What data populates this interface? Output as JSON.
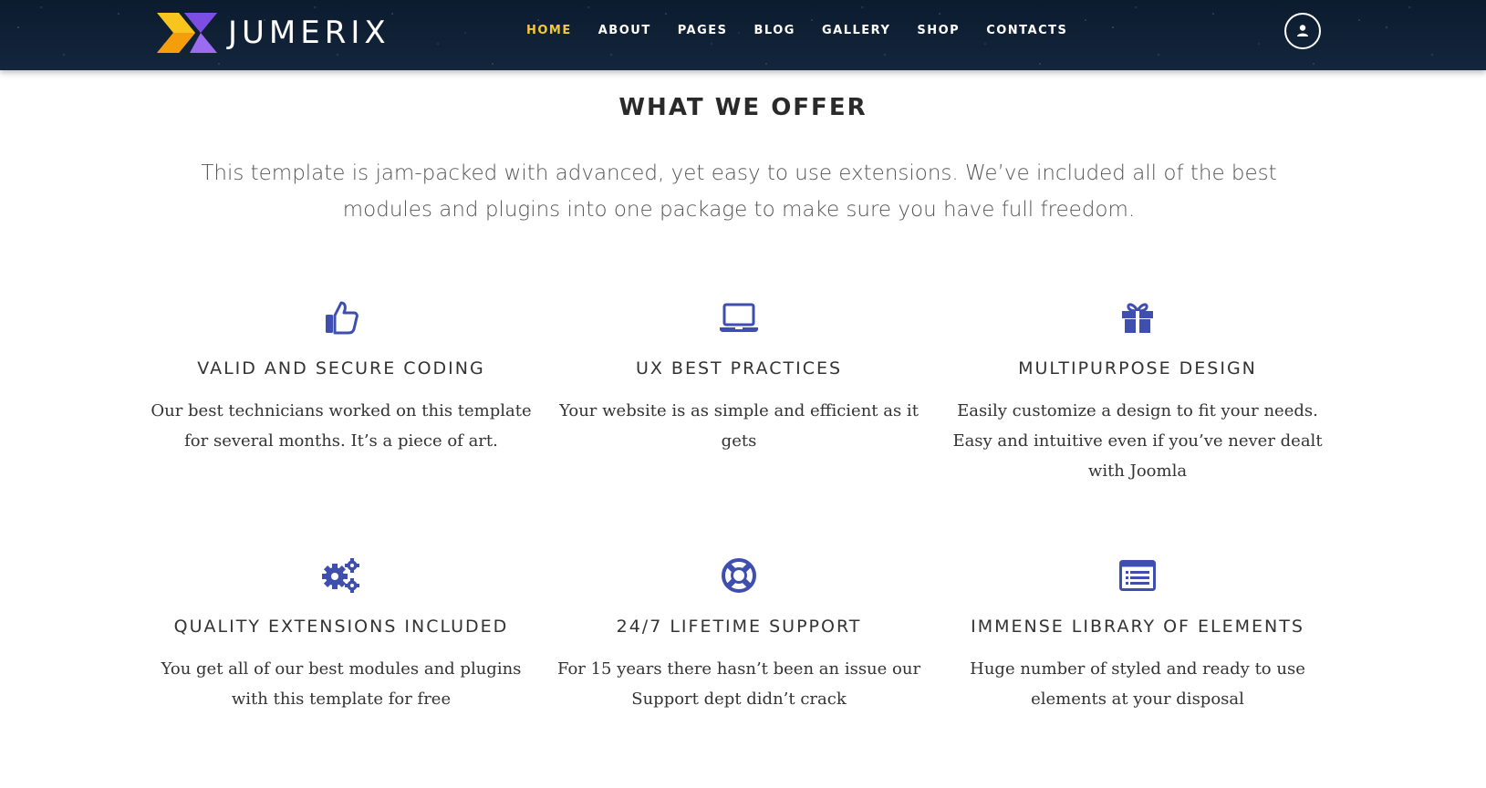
{
  "header": {
    "logo_text": "JUMERIX",
    "nav": [
      {
        "label": "HOME",
        "active": true
      },
      {
        "label": "ABOUT",
        "active": false
      },
      {
        "label": "PAGES",
        "active": false
      },
      {
        "label": "BLOG",
        "active": false
      },
      {
        "label": "GALLERY",
        "active": false
      },
      {
        "label": "SHOP",
        "active": false
      },
      {
        "label": "CONTACTS",
        "active": false
      }
    ],
    "user_icon": "user-icon"
  },
  "section": {
    "title": "WHAT WE OFFER",
    "intro": "This template is jam-packed with advanced, yet easy to use extensions. We’ve included all of the best modules and plugins into one package to make sure you have full freedom."
  },
  "features": [
    {
      "icon": "thumbs-up-icon",
      "title": "VALID AND SECURE CODING",
      "text": "Our best technicians worked on this template for several months. It’s a piece of art."
    },
    {
      "icon": "laptop-icon",
      "title": "UX BEST PRACTICES",
      "text": "Your website is as simple and efficient as it gets"
    },
    {
      "icon": "gift-icon",
      "title": "MULTIPURPOSE DESIGN",
      "text": "Easily customize a design to fit your needs. Easy and intuitive even if you’ve never dealt with Joomla"
    },
    {
      "icon": "gears-icon",
      "title": "QUALITY EXTENSIONS INCLUDED",
      "text": "You get all of our best modules and plugins with this template for free"
    },
    {
      "icon": "lifebuoy-icon",
      "title": "24/7 LIFETIME SUPPORT",
      "text": "For 15 years there hasn’t been an issue our Support dept didn’t crack"
    },
    {
      "icon": "list-icon",
      "title": "IMMENSE LIBRARY OF ELEMENTS",
      "text": "Huge number of styled and ready to use elements at your disposal"
    }
  ],
  "colors": {
    "accent_nav_active": "#f5c83a",
    "icon_blue": "#3f4fb0",
    "header_bg": "#0e1f33",
    "logo_yellow": "#f7c51e",
    "logo_purple": "#8b5cf6"
  }
}
